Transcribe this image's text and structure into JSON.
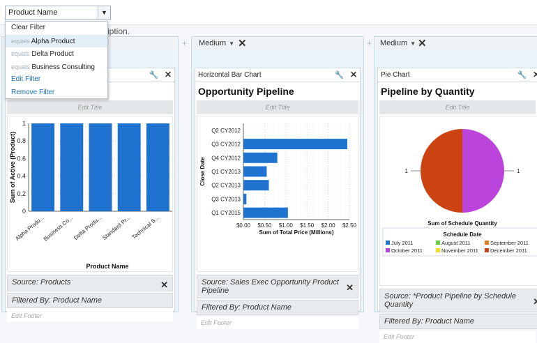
{
  "filter": {
    "selected": "Product Name",
    "menu": {
      "clear": "Clear Filter",
      "options": [
        {
          "prefix": "equals",
          "value": "Alpha Product"
        },
        {
          "prefix": "equals",
          "value": "Delta Product"
        },
        {
          "prefix": "equals",
          "value": "Business Consulting"
        }
      ],
      "edit": "Edit Filter",
      "remove": "Remove Filter"
    }
  },
  "hint_text": "ription.",
  "columns": [
    {
      "size": "",
      "show_size": false
    },
    {
      "size": "Medium",
      "show_size": true
    },
    {
      "size": "Medium",
      "show_size": true
    }
  ],
  "panels": [
    {
      "type_label": "",
      "title": "",
      "edit_title": "Edit Title",
      "source": "Source: Products",
      "filtered": "Filtered By: Product Name",
      "edit_footer": "Edit Footer"
    },
    {
      "type_label": "Horizontal Bar Chart",
      "title": "Opportunity Pipeline",
      "edit_title": "Edit Title",
      "source": "Source: Sales Exec Opportunity Product Pipeline",
      "filtered": "Filtered By: Product Name",
      "edit_footer": "Edit Footer"
    },
    {
      "type_label": "Pie Chart",
      "title": "Pipeline by Quantity",
      "edit_title": "Edit Title",
      "source": "Source: *Product Pipeline by Schedule Quantity",
      "filtered": "Filtered By: Product Name",
      "edit_footer": "Edit Footer"
    }
  ],
  "chart_data": [
    {
      "type": "bar",
      "categories": [
        "Alpha Produ...",
        "Business Co...",
        "Delta Produ...",
        "Standard Pr...",
        "Technical S..."
      ],
      "values": [
        1,
        1,
        1,
        1,
        1
      ],
      "xlabel": "Product Name",
      "ylabel": "Sum of Active (Product)",
      "ylim": [
        0,
        1
      ],
      "yticks": [
        "0",
        "0.2",
        "0.4",
        "0.6",
        "0.8",
        "1"
      ],
      "color": "#1f72d0"
    },
    {
      "type": "bar",
      "orientation": "horizontal",
      "categories": [
        "Q2 CY2012",
        "Q3 CY2012",
        "Q4 CY2012",
        "Q1 CY2013",
        "Q2 CY2013",
        "Q3 CY2013",
        "Q1 CY2015"
      ],
      "values": [
        0,
        2.45,
        0.8,
        0.55,
        0.6,
        0.07,
        1.05
      ],
      "xlabel": "Sum of Total Price (Millions)",
      "ylabel": "Close Date",
      "xlim": [
        0,
        2.5
      ],
      "xticks": [
        "$0.00",
        "$0.50",
        "$1.00",
        "$1.50",
        "$2.00",
        "$2.50"
      ],
      "color": "#1f72d0"
    },
    {
      "type": "pie",
      "title": "Sum of Schedule Quantity",
      "legend_title": "Schedule Date",
      "slices": [
        {
          "label": "July 2011",
          "value": 0,
          "color": "#1f72d0"
        },
        {
          "label": "August 2011",
          "value": 0,
          "color": "#66cc44"
        },
        {
          "label": "September 2011",
          "value": 0,
          "color": "#ee7722"
        },
        {
          "label": "October 2011",
          "value": 1,
          "color": "#bb44dd"
        },
        {
          "label": "November 2011",
          "value": 0,
          "color": "#eedd22"
        },
        {
          "label": "December 2011",
          "value": 1,
          "color": "#cc4411"
        }
      ],
      "data_labels": [
        "1",
        "1"
      ]
    }
  ]
}
